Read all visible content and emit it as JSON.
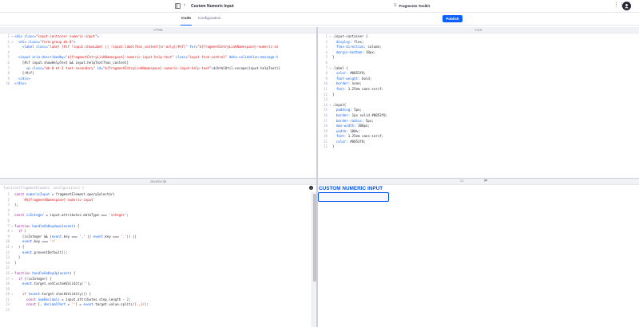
{
  "header": {
    "title": "Custom Numeric Input",
    "back_glyph": "‹",
    "toolkit_label": "Fragments Toolkit",
    "toolkit_icon": "≡",
    "apps_glyph": "⋮⋮⋮",
    "avatar_initial": "•",
    "publish_label": "Publish"
  },
  "tabs": [
    {
      "label": "Code",
      "active": true
    },
    {
      "label": "Configuration",
      "active": false
    }
  ],
  "panes": {
    "html_title": "HTML",
    "css_title": "CSS",
    "js_title": "JavaScript",
    "js_signature": "function(fragmentElement, configuration) {"
  },
  "html_code": [
    {
      "n": "1",
      "f": "▾",
      "html": "<span class='t'>&lt;div</span> <span class='a'>class=</span><span class='s'>\"input-container numeric-input\"</span><span class='t'>&gt;</span>"
    },
    {
      "n": "2",
      "f": "▾",
      "html": "  <span class='t'>&lt;div</span> <span class='a'>class=</span><span class='s'>\"form-group mb-0\"</span><span class='t'>&gt;</span>"
    },
    {
      "n": "3",
      "f": "",
      "html": "    <span class='t'>&lt;label</span> <span class='a'>class=</span><span class='s'>\"label [#if !input.showLabel || !input.label?has_content]sr-only[/#if]\"</span> <span class='a'>for=</span><span class='s'>\"${fragmentEntryLinkNamespace}-numeric-in</span>"
    },
    {
      "n": "4",
      "f": "",
      "html": ""
    },
    {
      "n": "5",
      "f": "",
      "html": "  <span class='t'>&lt;input</span> <span class='a'>aria-describedby=</span><span class='s'>\"${fragmentEntryLinkNamespace}-numeric-input-help-text\"</span> <span class='a'>class=</span><span class='s'>\"input form-control\"</span> <span class='a'>data-validation-message-t</span>"
    },
    {
      "n": "6",
      "f": "",
      "html": "    <span class='m'>[#if input.showHelpText &amp;&amp; input.helpText?has_content]</span>"
    },
    {
      "n": "7",
      "f": "",
      "html": "      <span class='t'>&lt;p</span> <span class='a'>class=</span><span class='s'>\"mb-0 mt-1 text-secondary\"</span> <span class='a'>id=</span><span class='s'>\"${fragmentEntryLinkNamespace}-numeric-input-help-text\"</span><span class='t'>&gt;</span><span class='m'>${htmlUtil.escape(input.helpText)}</span>"
    },
    {
      "n": "8",
      "f": "",
      "html": "    <span class='m'>[/#if]</span>"
    },
    {
      "n": "9",
      "f": "",
      "html": "  <span class='t'>&lt;/div&gt;</span>"
    },
    {
      "n": "10",
      "f": "",
      "html": "<span class='t'>&lt;/div&gt;</span>"
    }
  ],
  "css_code": [
    {
      "n": "1",
      "f": "▾",
      "html": "<span class='m'>.input-container {</span>"
    },
    {
      "n": "2",
      "f": "",
      "html": "  <span class='n'>display:</span> <span class='m'>flex;</span>"
    },
    {
      "n": "3",
      "f": "",
      "html": "  <span class='n'>flex-direction:</span> <span class='m'>column;</span>"
    },
    {
      "n": "4",
      "f": "",
      "html": "  <span class='n'>margin-bottom:</span> <span class='m'>10px;</span>"
    },
    {
      "n": "5",
      "f": "",
      "html": "<span class='m'>}</span>"
    },
    {
      "n": "6",
      "f": "",
      "html": ""
    },
    {
      "n": "7",
      "f": "▾",
      "html": "<span class='m'>.label {</span>"
    },
    {
      "n": "8",
      "f": "",
      "html": "  <span class='n'>color:</span> <span class='m'>#0053f0;</span>"
    },
    {
      "n": "9",
      "f": "",
      "html": "  <span class='n'>font-weight:</span> <span class='m'>bold;</span>"
    },
    {
      "n": "10",
      "f": "",
      "html": "  <span class='n'>border:</span> <span class='m'>none;</span>"
    },
    {
      "n": "11",
      "f": "",
      "html": "  <span class='n'>font:</span> <span class='m'>1.25em sans-serif;</span>"
    },
    {
      "n": "12",
      "f": "",
      "html": "<span class='m'>}</span>"
    },
    {
      "n": "13",
      "f": "",
      "html": ""
    },
    {
      "n": "14",
      "f": "▾",
      "html": "<span class='m'>.input{</span>"
    },
    {
      "n": "15",
      "f": "",
      "html": "  <span class='n'>padding:</span> <span class='m'>5px;</span>"
    },
    {
      "n": "16",
      "f": "",
      "html": "  <span class='n'>border:</span> <span class='m'>1px solid #0053f0;</span>"
    },
    {
      "n": "17",
      "f": "",
      "html": "  <span class='n'>border-radius:</span> <span class='m'>5px;</span>"
    },
    {
      "n": "18",
      "f": "",
      "html": "  <span class='n'>max-width:</span> <span class='m'>300px;</span>"
    },
    {
      "n": "19",
      "f": "",
      "html": "  <span class='n'>width:</span> <span class='m'>100%;</span>"
    },
    {
      "n": "20",
      "f": "",
      "html": "  <span class='n'>font:</span> <span class='m'>1.25em sans-serif;</span>"
    },
    {
      "n": "21",
      "f": "",
      "html": "  <span class='n'>color:</span> <span class='m'>#0053f0;</span>"
    },
    {
      "n": "22",
      "f": "",
      "html": "<span class='m'>}</span>"
    }
  ],
  "js_code": [
    {
      "n": "1",
      "f": "",
      "html": "<span class='k'>const</span> <span class='n'>numericInput</span> = fragmentElement.querySelector("
    },
    {
      "n": "2",
      "f": "",
      "html": "    <span class='s'>`#${fragmentNamespace}-numeric-input`</span>"
    },
    {
      "n": "3",
      "f": "",
      "html": ");"
    },
    {
      "n": "4",
      "f": "",
      "html": ""
    },
    {
      "n": "5",
      "f": "",
      "html": "<span class='k'>const</span> <span class='n'>isInteger</span> = input.attributes.dataType === <span class='s'>'integer'</span>;"
    },
    {
      "n": "6",
      "f": "",
      "html": ""
    },
    {
      "n": "7",
      "f": "▾",
      "html": "<span class='k'>function</span> <span class='n'>handleOnKeydown</span>(<span class='n'>event</span>) {"
    },
    {
      "n": "8",
      "f": "▾",
      "html": "  <span class='k'>if</span> ("
    },
    {
      "n": "9",
      "f": "",
      "html": "    (isInteger &amp;&amp; (<span class='n'>event</span>.key === <span class='s'>','</span> || <span class='n'>event</span>.key === <span class='s'>'.'</span>)) ||"
    },
    {
      "n": "10",
      "f": "",
      "html": "    <span class='n'>event</span>.key === <span class='s'>'+'</span>"
    },
    {
      "n": "11",
      "f": "▾",
      "html": "  ) {"
    },
    {
      "n": "12",
      "f": "",
      "html": "    <span class='n'>event</span>.preventDefault();"
    },
    {
      "n": "13",
      "f": "",
      "html": "  }"
    },
    {
      "n": "14",
      "f": "",
      "html": "}"
    },
    {
      "n": "15",
      "f": "",
      "html": ""
    },
    {
      "n": "16",
      "f": "▾",
      "html": "<span class='k'>function</span> <span class='n'>handleOnKeyUp</span>(<span class='n'>event</span>) {"
    },
    {
      "n": "17",
      "f": "▾",
      "html": "  <span class='k'>if</span> (!isInteger) {"
    },
    {
      "n": "18",
      "f": "",
      "html": "    <span class='n'>event</span>.target.setCustomValidity(<span class='s'>''</span>);"
    },
    {
      "n": "19",
      "f": "",
      "html": ""
    },
    {
      "n": "20",
      "f": "▾",
      "html": "    <span class='k'>if</span> (<span class='n'>event</span>.target.checkValidity()) {"
    },
    {
      "n": "21",
      "f": "",
      "html": "      <span class='k'>const</span> <span class='n'>numDecimals</span> = input.attributes.step.length - <span class='g'>2</span>;"
    },
    {
      "n": "22",
      "f": "",
      "html": "      <span class='k'>const</span> [, <span class='n'>decimalPart</span> = <span class='s'>''</span>] = <span class='n'>event</span>.target.value.split(<span class='s'>/[.,]/</span>);"
    },
    {
      "n": "23",
      "f": "",
      "html": ""
    }
  ],
  "preview": {
    "label": "CUSTOM NUMERIC INPUT",
    "input_value": "",
    "desktop_icon": "▭",
    "rotate_icon": "⇄"
  },
  "colors": {
    "accent": "#0b5fff",
    "preview_blue": "#0053f0"
  }
}
